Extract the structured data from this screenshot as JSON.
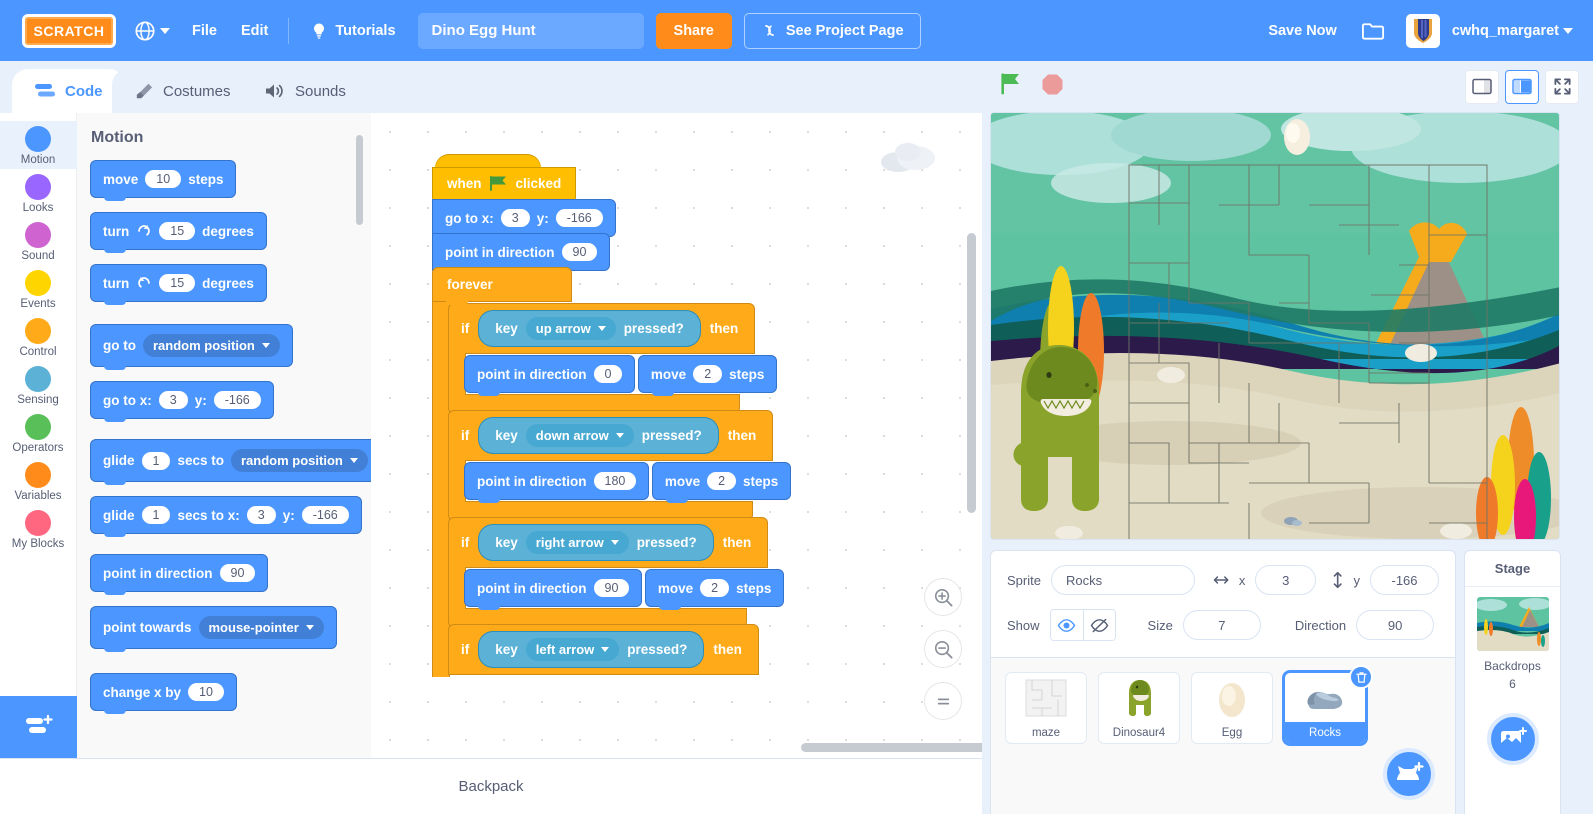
{
  "menubar": {
    "logo_text": "SCRATCH",
    "globe_icon": "globe-icon",
    "file_label": "File",
    "edit_label": "Edit",
    "tutorials_label": "Tutorials",
    "tutorials_icon": "lightbulb-icon",
    "project_title": "Dino Egg Hunt",
    "project_title_placeholder": "Project title",
    "share_label": "Share",
    "see_project_page_label": "See Project Page",
    "see_project_page_icon": "refresh-icon",
    "save_now_label": "Save Now",
    "folder_icon": "folder-icon",
    "username": "cwhq_margaret",
    "avatar_icon": "user-avatar-icon",
    "accent_blue": "#4c97ff",
    "accent_orange": "#ff8c1a"
  },
  "tabs": [
    {
      "label": "Code",
      "icon": "code-icon",
      "active": true
    },
    {
      "label": "Costumes",
      "icon": "paintbrush-icon",
      "active": false
    },
    {
      "label": "Sounds",
      "icon": "speaker-icon",
      "active": false
    }
  ],
  "categories": [
    {
      "label": "Motion",
      "color": "#4c97ff",
      "selected": true
    },
    {
      "label": "Looks",
      "color": "#9966ff",
      "selected": false
    },
    {
      "label": "Sound",
      "color": "#cf63cf",
      "selected": false
    },
    {
      "label": "Events",
      "color": "#ffd500",
      "selected": false
    },
    {
      "label": "Control",
      "color": "#ffab19",
      "selected": false
    },
    {
      "label": "Sensing",
      "color": "#5cb1d6",
      "selected": false
    },
    {
      "label": "Operators",
      "color": "#59c059",
      "selected": false
    },
    {
      "label": "Variables",
      "color": "#ff8c1a",
      "selected": false
    },
    {
      "label": "My Blocks",
      "color": "#ff6680",
      "selected": false
    }
  ],
  "add_extension_icon": "add-extension-icon",
  "palette": {
    "header": "Motion",
    "blocks": {
      "move_label": "move",
      "move_value": "10",
      "move_units": "steps",
      "turn_cw_label": "turn",
      "turn_cw_value": "15",
      "turn_cw_units": "degrees",
      "turn_cw_icon": "rotate-cw-icon",
      "turn_ccw_label": "turn",
      "turn_ccw_value": "15",
      "turn_ccw_units": "degrees",
      "turn_ccw_icon": "rotate-ccw-icon",
      "goto_label": "go to",
      "goto_target": "random position",
      "gotoxy_label": "go to x:",
      "gotoxy_x": "3",
      "gotoxy_ylabel": "y:",
      "gotoxy_y": "-166",
      "glide_label": "glide",
      "glide_secs": "1",
      "glide_mid": "secs to",
      "glide_target": "random position",
      "glidexy_label": "glide",
      "glidexy_secs": "1",
      "glidexy_mid": "secs to x:",
      "glidexy_x": "3",
      "glidexy_ylabel": "y:",
      "glidexy_y": "-166",
      "pointdir_label": "point in direction",
      "pointdir_value": "90",
      "pointtowards_label": "point towards",
      "pointtowards_target": "mouse-pointer",
      "changex_label": "change x by",
      "changex_value": "10"
    }
  },
  "script": {
    "hat_prefix": "when",
    "hat_icon": "green-flag-icon",
    "hat_suffix": "clicked",
    "goto_label": "go to x:",
    "goto_x": "3",
    "goto_ylabel": "y:",
    "goto_y": "-166",
    "pointdir_label": "point in direction",
    "pointdir_value": "90",
    "forever_label": "forever",
    "if_label": "if",
    "key_label": "key",
    "pressed_label": "pressed?",
    "then_label": "then",
    "branches": [
      {
        "key": "up arrow",
        "point_label": "point in direction",
        "direction": "0",
        "move_label": "move",
        "steps": "2",
        "steps_units": "steps"
      },
      {
        "key": "down arrow",
        "point_label": "point in direction",
        "direction": "180",
        "move_label": "move",
        "steps": "2",
        "steps_units": "steps"
      },
      {
        "key": "right arrow",
        "point_label": "point in direction",
        "direction": "90",
        "move_label": "move",
        "steps": "2",
        "steps_units": "steps"
      }
    ],
    "partial_branch_key": "left arrow"
  },
  "canvas": {
    "zoom_in_icon": "zoom-in-icon",
    "zoom_out_icon": "zoom-out-icon",
    "zoom_reset_icon": "zoom-reset-icon",
    "cloud_icon": "cloud-icon"
  },
  "backpack": {
    "label": "Backpack"
  },
  "stage_controls": {
    "green_flag_icon": "green-flag-icon",
    "stop_icon": "stop-sign-icon",
    "small_stage_icon": "small-stage-icon",
    "large_stage_icon": "large-stage-icon",
    "fullscreen_icon": "fullscreen-icon",
    "active_size": "large"
  },
  "sprite_info": {
    "sprite_label": "Sprite",
    "sprite_name": "Rocks",
    "x_icon": "horizontal-arrows-icon",
    "x_label": "x",
    "x_value": "3",
    "y_icon": "vertical-arrows-icon",
    "y_label": "y",
    "y_value": "-166",
    "show_label": "Show",
    "show_on_icon": "eye-icon",
    "show_off_icon": "eye-slash-icon",
    "show_on": true,
    "size_label": "Size",
    "size_value": "7",
    "direction_label": "Direction",
    "direction_value": "90"
  },
  "sprites": [
    {
      "name": "maze",
      "selected": false,
      "thumb": "maze-thumb"
    },
    {
      "name": "Dinosaur4",
      "selected": false,
      "thumb": "dinosaur-thumb"
    },
    {
      "name": "Egg",
      "selected": false,
      "thumb": "egg-thumb"
    },
    {
      "name": "Rocks",
      "selected": true,
      "thumb": "rocks-thumb"
    }
  ],
  "add_sprite_icon": "add-sprite-cat-icon",
  "delete_sprite_icon": "trash-icon",
  "stage_panel": {
    "header": "Stage",
    "backdrops_label": "Backdrops",
    "backdrops_count": "6",
    "add_backdrop_icon": "add-backdrop-icon"
  }
}
